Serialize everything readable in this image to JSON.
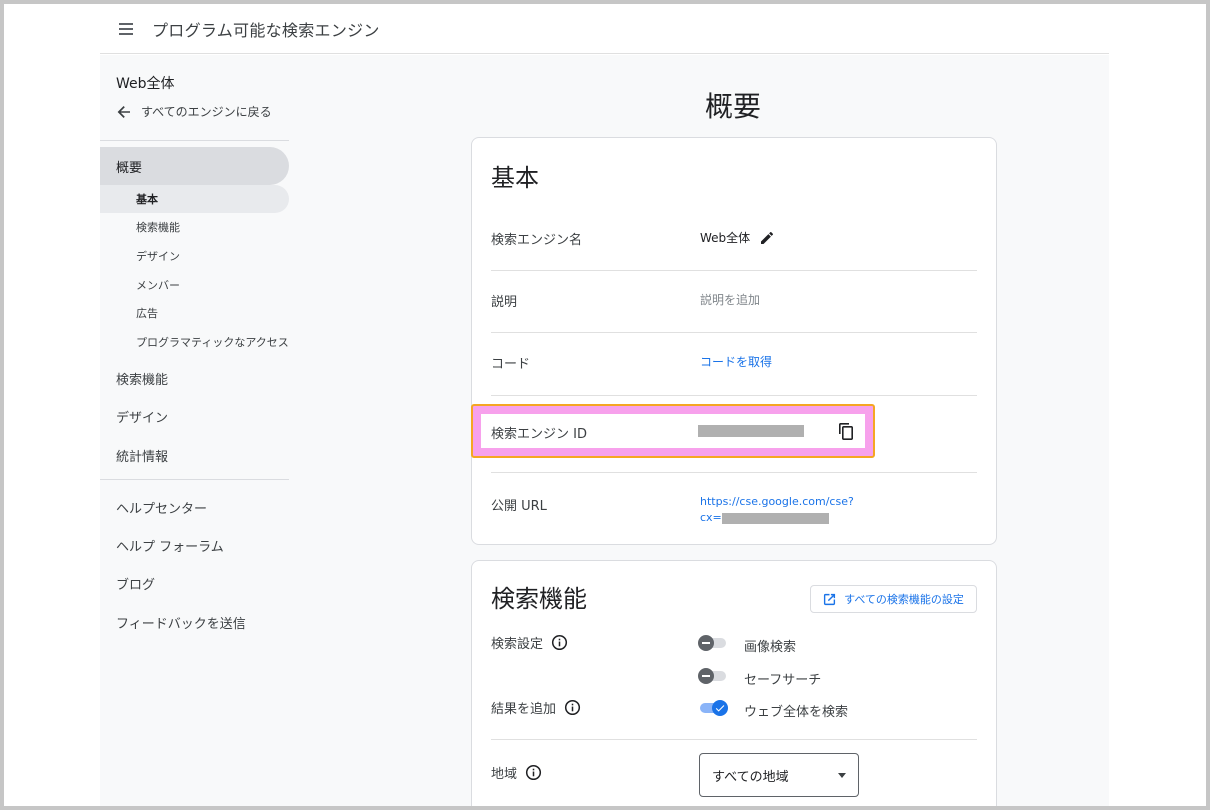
{
  "header": {
    "title": "プログラム可能な検索エンジン",
    "menu_icon": "menu-icon"
  },
  "sidebar": {
    "engine_name": "Web全体",
    "back_label": "すべてのエンジンに戻る",
    "main_item": "概要",
    "sub_items": [
      {
        "label": "基本",
        "active": true
      },
      {
        "label": "検索機能",
        "active": false
      },
      {
        "label": "デザイン",
        "active": false
      },
      {
        "label": "メンバー",
        "active": false
      },
      {
        "label": "広告",
        "active": false
      },
      {
        "label": "プログラマティックなアクセス",
        "active": false
      }
    ],
    "items": [
      {
        "label": "検索機能"
      },
      {
        "label": "デザイン"
      },
      {
        "label": "統計情報"
      }
    ],
    "help_items": [
      {
        "label": "ヘルプセンター"
      },
      {
        "label": "ヘルプ フォーラム"
      },
      {
        "label": "ブログ"
      },
      {
        "label": "フィードバックを送信"
      }
    ]
  },
  "main": {
    "page_title": "概要",
    "basic": {
      "title": "基本",
      "name_label": "検索エンジン名",
      "name_value": "Web全体",
      "description_label": "説明",
      "description_placeholder": "説明を追加",
      "code_label": "コード",
      "code_link": "コードを取得",
      "id_label": "検索エンジン ID",
      "url_label": "公開 URL",
      "url_line1": "https://cse.google.com/cse?",
      "url_line2_prefix": "cx="
    },
    "features": {
      "title": "検索機能",
      "all_settings_button": "すべての検索機能の設定",
      "search_settings_label": "検索設定",
      "add_results_label": "結果を追加",
      "toggles": [
        {
          "label": "画像検索",
          "on": false
        },
        {
          "label": "セーフサーチ",
          "on": false
        },
        {
          "label": "ウェブ全体を検索",
          "on": true
        }
      ],
      "region_label": "地域",
      "region_value": "すべての地域"
    }
  },
  "colors": {
    "accent": "#1a73e8",
    "highlight_fill": "#f7a1ec",
    "highlight_border": "#f5a623"
  }
}
